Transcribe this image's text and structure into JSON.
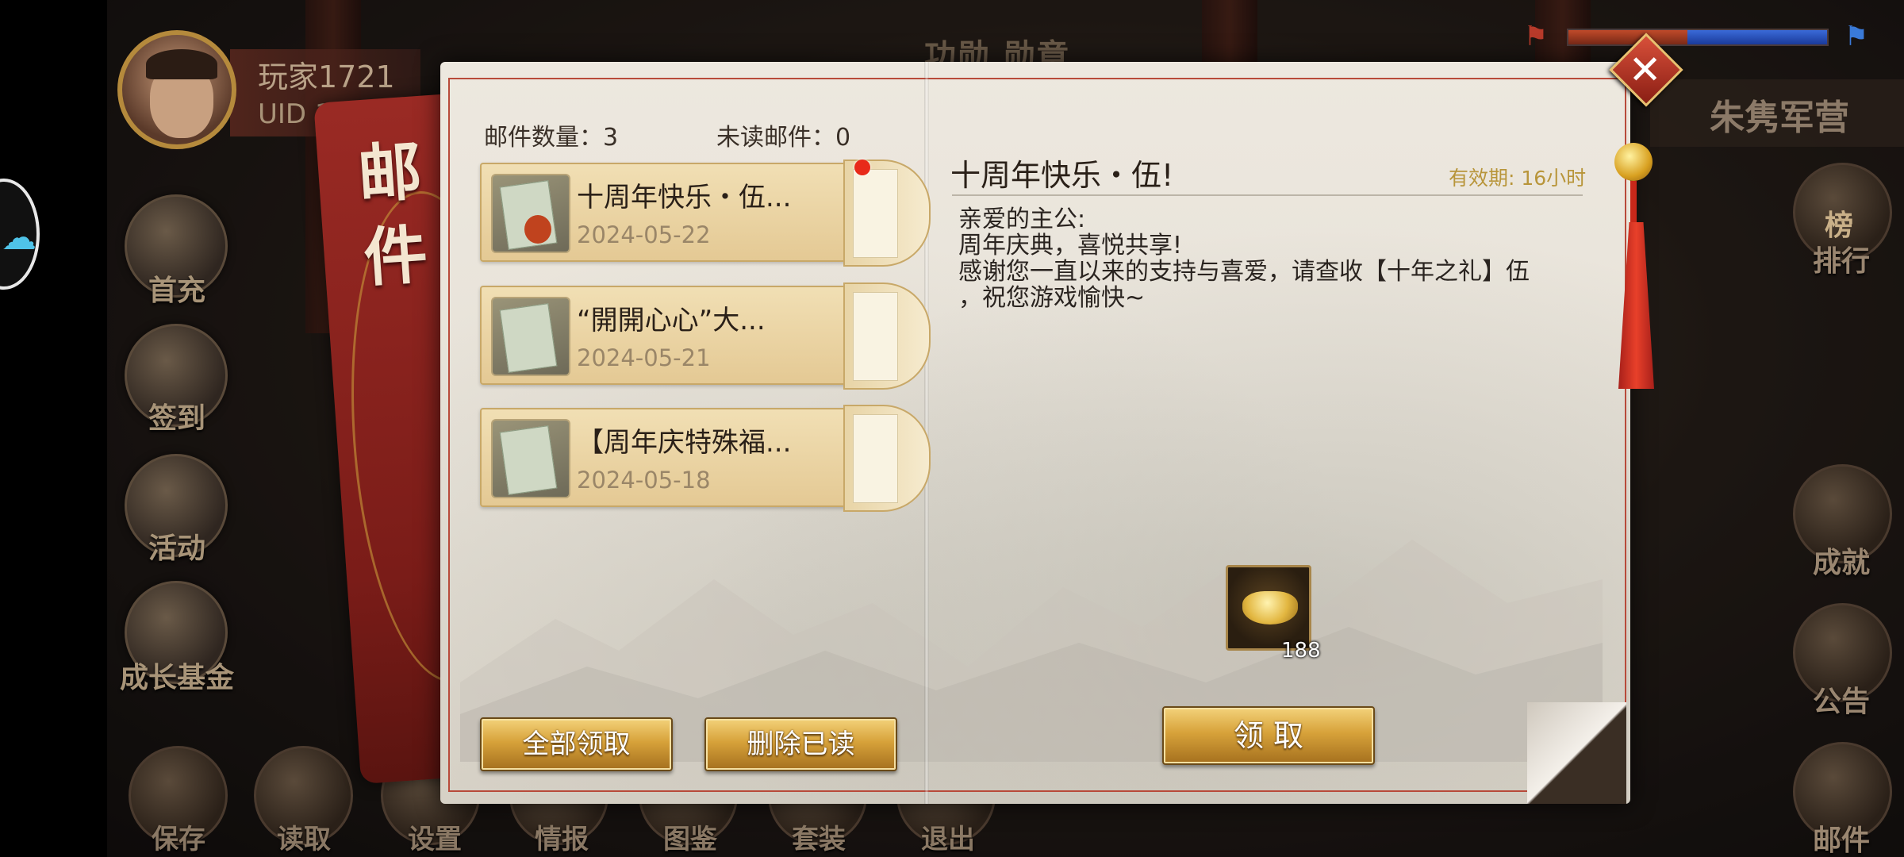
{
  "player": {
    "name": "玩家1721",
    "uid": "UID 1721"
  },
  "top_bar": {
    "title": "功勋 勋章",
    "camp": "朱隽军营"
  },
  "left_menu": [
    {
      "label": "首充",
      "icon": "treasure-bag-icon"
    },
    {
      "label": "签到",
      "icon": "scroll-sign-icon"
    },
    {
      "label": "活动",
      "icon": "gold-pile-icon"
    },
    {
      "label": "成长基金",
      "icon": "flower-pot-icon"
    }
  ],
  "right_menu": [
    {
      "label": "排行",
      "icon": "rank-board-icon",
      "glyph": "榜"
    },
    {
      "label": "成就",
      "icon": "achievement-chest-icon",
      "glyph": ""
    },
    {
      "label": "公告",
      "icon": "announcement-scroll-icon",
      "glyph": ""
    },
    {
      "label": "邮件",
      "icon": "mail-scroll-icon",
      "glyph": ""
    }
  ],
  "bottom_menu": [
    {
      "label": "保存"
    },
    {
      "label": "读取"
    },
    {
      "label": "设置"
    },
    {
      "label": "情报"
    },
    {
      "label": "图鉴"
    },
    {
      "label": "套装"
    },
    {
      "label": "退出"
    }
  ],
  "mail_panel": {
    "cover_title": "邮件",
    "mail_count_label": "邮件数量：3",
    "unread_label": "未读邮件：0",
    "mails": [
      {
        "title": "十周年快乐・伍...",
        "date": "2024-05-22",
        "has_dot": true
      },
      {
        "title": "“開開心心”大...",
        "date": "2024-05-21",
        "has_dot": false
      },
      {
        "title": "【周年庆特殊福...",
        "date": "2024-05-18",
        "has_dot": false
      }
    ],
    "claim_all_label": "全部领取",
    "delete_read_label": "删除已读"
  },
  "mail_detail": {
    "title": "十周年快乐・伍!",
    "expiry": "有效期:   16小时",
    "body_lines": [
      "亲爱的主公:",
      "周年庆典，喜悦共享!",
      "感谢您一直以来的支持与喜爱，请查收【十年之礼】伍",
      "，祝您游戏愉快~"
    ],
    "reward": {
      "icon": "gold-ingot-icon",
      "count": "188"
    },
    "claim_label": "领    取"
  },
  "colors": {
    "gold_button": "#d7a23a",
    "paper": "#e6e1d7",
    "cover_red": "#9a2a24",
    "unread_dot": "#e82a1a"
  }
}
